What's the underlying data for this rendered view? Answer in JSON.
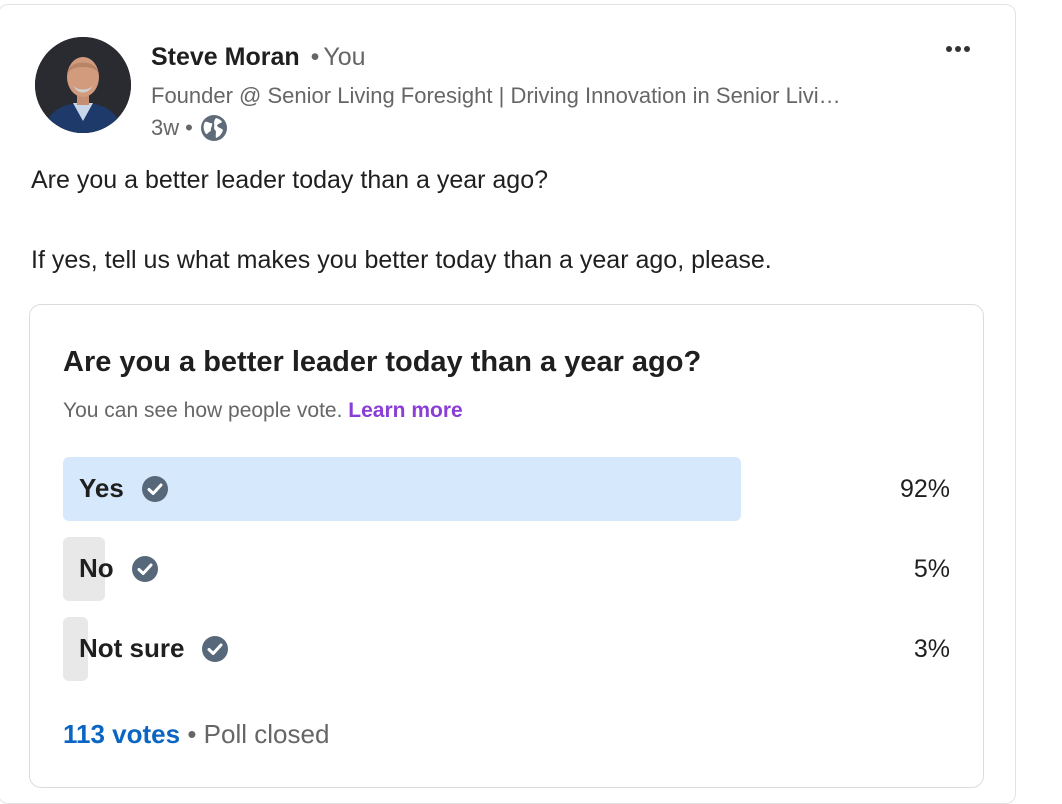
{
  "author": {
    "name": "Steve Moran",
    "separator": "•",
    "relation": "You",
    "headline": "Founder @ Senior Living Foresight | Driving Innovation in Senior Livi…",
    "time_ago": "3w",
    "meta_separator": "•",
    "visibility_icon": "globe-icon",
    "avatar": "avatar-photo"
  },
  "menu": {
    "icon": "more-options-icon"
  },
  "post": {
    "line1": "Are you a better leader today than a year ago?",
    "line2": "If yes, tell us what makes you better today than a year ago, please."
  },
  "poll": {
    "question": "Are you a better leader today than a year ago?",
    "note": "You can see how people vote.",
    "learn_more": "Learn more",
    "options": [
      {
        "label": "Yes",
        "percent_text": "92%",
        "percent": 92,
        "voted": true
      },
      {
        "label": "No",
        "percent_text": "5%",
        "percent": 5,
        "voted": false
      },
      {
        "label": "Not sure",
        "percent_text": "3%",
        "percent": 3,
        "voted": false
      }
    ],
    "votes": "113 votes",
    "footer_separator": "•",
    "status": "Poll closed"
  },
  "colors": {
    "selected_bar": "#d6e8fb",
    "unselected_bar": "#e8e8e8",
    "link_blue": "#0a66c2",
    "learn_more_purple": "#8a3ed6",
    "check_icon": "#56687a"
  }
}
